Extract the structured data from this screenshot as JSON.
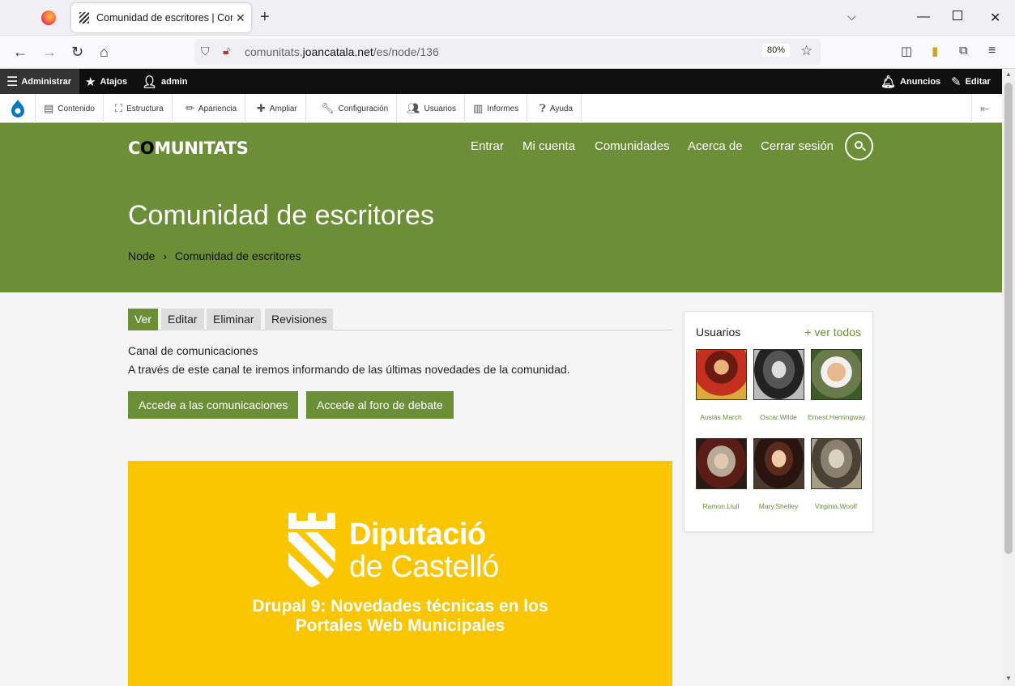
{
  "browser": {
    "tab_title": "Comunidad de escritores | Com",
    "url_domain_prefix": "comunitats.",
    "url_domain": "joancatala.net",
    "url_path": "/es/node/136",
    "zoom": "80%"
  },
  "admin_toolbar": {
    "manage": "Administrar",
    "shortcuts": "Atajos",
    "user": "admin",
    "announcements": "Anuncios",
    "edit": "Editar",
    "tray": [
      "Contenido",
      "Estructura",
      "Apariencia",
      "Ampliar",
      "Configuración",
      "Usuarios",
      "Informes",
      "Ayuda"
    ]
  },
  "site": {
    "logo_prefix": "C",
    "logo_o": "O",
    "logo_rest": "MUNITATS",
    "nav": [
      "Entrar",
      "Mi cuenta",
      "Comunidades",
      "Acerca de",
      "Cerrar sesión"
    ],
    "page_title": "Comunidad de escritores",
    "breadcrumb_home": "Node",
    "breadcrumb_sep": "›",
    "breadcrumb_current": "Comunidad de escritores"
  },
  "local_tabs": [
    "Ver",
    "Editar",
    "Eliminar",
    "Revisiones"
  ],
  "content": {
    "label": "Canal de comunicaciones",
    "text": "A través de este canal te iremos informando de las últimas novedades de la comunidad.",
    "button_comms": "Accede a las comunicaciones",
    "button_forum": "Accede al foro de debate"
  },
  "banner": {
    "org_line1": "Diputació",
    "org_line2": "de Castelló",
    "title_line1": "Drupal 9: Novedades técnicas en los",
    "title_line2": "Portales Web Municipales"
  },
  "sidebar": {
    "title": "Usuarios",
    "see_all": "+ ver todos",
    "users": [
      "Ausiàs.March",
      "Oscar.Wilde",
      "Ernest.Hemingway",
      "Ramon.Llull",
      "Mary.Shelley",
      "Virginia.Woolf"
    ]
  },
  "colors": {
    "brand_green": "#6b8e36",
    "banner_yellow": "#f9c600"
  }
}
